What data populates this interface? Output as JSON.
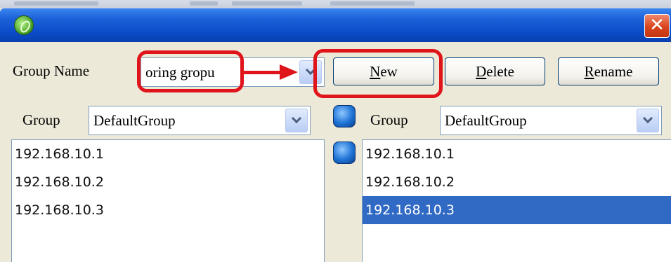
{
  "window": {
    "close_glyph": "✕"
  },
  "group_name": {
    "label": "Group Name",
    "value": "oring gropu"
  },
  "buttons": {
    "new_mnemonic": "N",
    "new_rest": "ew",
    "delete_mnemonic": "D",
    "delete_rest": "elete",
    "rename_mnemonic": "R",
    "rename_rest": "ename"
  },
  "left_panel": {
    "group_label": "Group",
    "selected_group": "DefaultGroup",
    "items": [
      "192.168.10.1",
      "192.168.10.2",
      "192.168.10.3"
    ]
  },
  "right_panel": {
    "group_label": "Group",
    "selected_group": "DefaultGroup",
    "items": [
      "192.168.10.1",
      "192.168.10.2",
      "192.168.10.3"
    ],
    "selected_index": 2
  },
  "colors": {
    "highlight": "#e0141b",
    "selection": "#316ac5"
  },
  "icons": {
    "app": "app-icon",
    "close": "close-icon",
    "dropdown": "chevron-down-icon",
    "move_right": "move-right-icon",
    "move_left": "move-left-icon"
  }
}
